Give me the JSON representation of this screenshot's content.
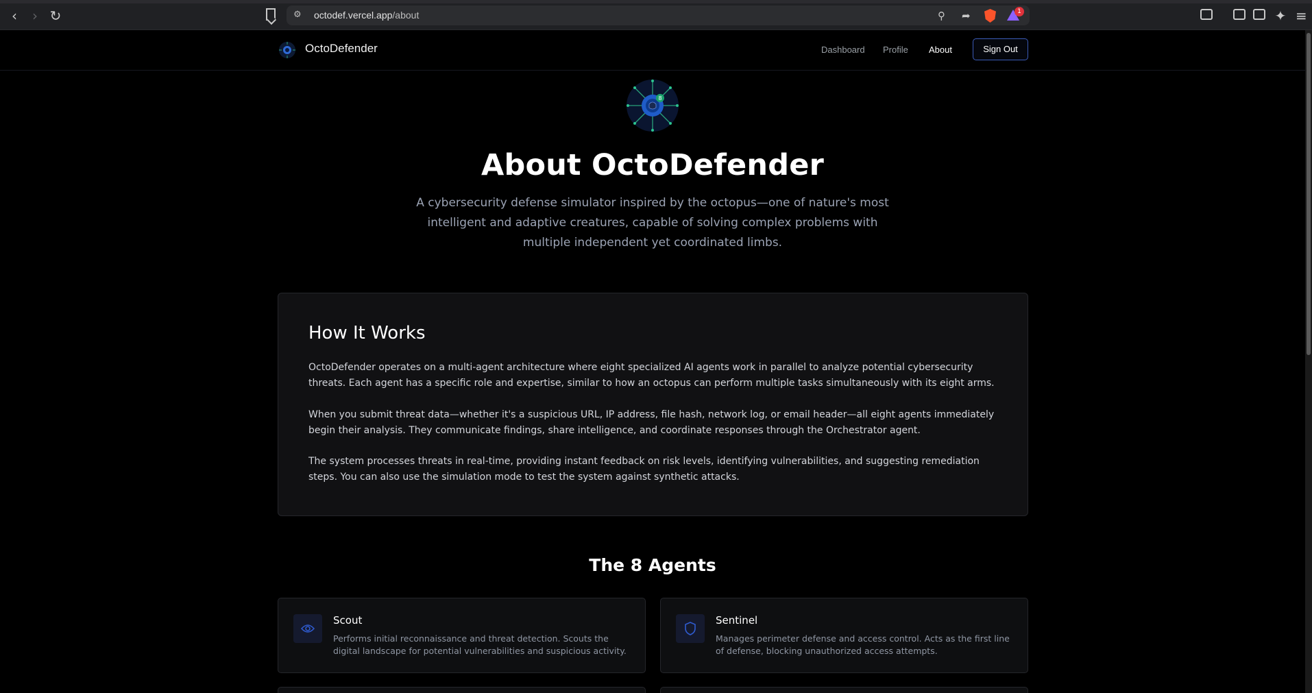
{
  "browser": {
    "url_host": "octodef.vercel.app",
    "url_path": "/about",
    "brave_badge_count": "1"
  },
  "header": {
    "brand": "OctoDefender",
    "nav": [
      {
        "label": "Dashboard"
      },
      {
        "label": "Profile"
      },
      {
        "label": "About"
      }
    ],
    "signout_label": "Sign Out"
  },
  "hero": {
    "title": "About OctoDefender",
    "subtitle": "A cybersecurity defense simulator inspired by the octopus—one of nature's most intelligent and adaptive creatures, capable of solving complex problems with multiple independent yet coordinated limbs.",
    "badge_number": "8"
  },
  "how_it_works": {
    "title": "How It Works",
    "paragraphs": [
      "OctoDefender operates on a multi-agent architecture where eight specialized AI agents work in parallel to analyze potential cybersecurity threats. Each agent has a specific role and expertise, similar to how an octopus can perform multiple tasks simultaneously with its eight arms.",
      "When you submit threat data—whether it's a suspicious URL, IP address, file hash, network log, or email header—all eight agents immediately begin their analysis. They communicate findings, share intelligence, and coordinate responses through the Orchestrator agent.",
      "The system processes threats in real-time, providing instant feedback on risk levels, identifying vulnerabilities, and suggesting remediation steps. You can also use the simulation mode to test the system against synthetic attacks."
    ]
  },
  "agents_section": {
    "title": "The 8 Agents",
    "agents": [
      {
        "name": "Scout",
        "icon": "eye-icon",
        "description": "Performs initial reconnaissance and threat detection. Scouts the digital landscape for potential vulnerabilities and suspicious activity."
      },
      {
        "name": "Sentinel",
        "icon": "shield-icon",
        "description": "Manages perimeter defense and access control. Acts as the first line of defense, blocking unauthorized access attempts."
      }
    ]
  },
  "colors": {
    "background": "#000000",
    "card": "#111113",
    "accent_blue": "#3b5bb8",
    "text_muted": "#9ba3b4"
  }
}
